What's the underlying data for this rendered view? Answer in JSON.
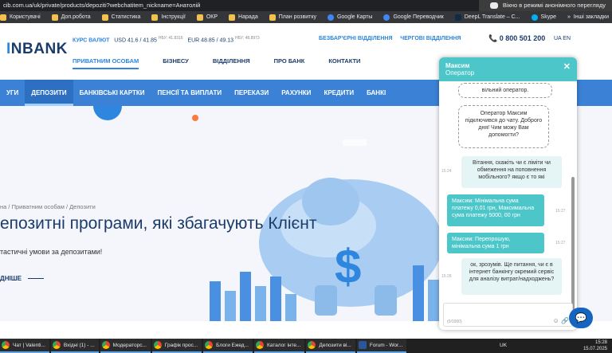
{
  "browser": {
    "url": "cib.com.ua/uk/private/products/depoziti?webchatitem_nickname=Анатолій",
    "incognito_label": "Вікно в режимі анонімного перегляду",
    "bookmarks": [
      "Користувачі",
      "Доп.робота",
      "Статистика",
      "Інструкції",
      "ОКР",
      "Нарада",
      "План розвитку",
      "Google Карты",
      "Google Переводчик",
      "DeepL Translate – С...",
      "Skype"
    ],
    "bookmarks_more": "Інші закладки"
  },
  "header": {
    "logo": "NBANK",
    "logo_prefix": "I",
    "rates_label": "КУРС ВАЛЮТ",
    "usd_label": "USD",
    "usd_value": "41.6 / 41.85",
    "usd_nbu": "НБУ: 41.8316",
    "eur_label": "EUR",
    "eur_value": "48.85 / 49.13",
    "eur_nbu": "НБУ: 48.8973",
    "link_branches": "БЕЗБАР'ЄРНІ ВІДДІЛЕННЯ",
    "link_duty": "ЧЕРГОВІ ВІДДІЛЕННЯ",
    "phone": "0 800 501 200",
    "lang": "UA EN",
    "main_nav": [
      "ПРИВАТНИМ ОСОБАМ",
      "БІЗНЕСУ",
      "ВІДДІЛЕННЯ",
      "ПРО БАНК",
      "КОНТАКТИ"
    ],
    "sub_nav": [
      "УГИ",
      "ДЕПОЗИТИ",
      "БАНКІВСЬКІ КАРТКИ",
      "ПЕНСІЇ ТА ВИПЛАТИ",
      "ПЕРЕКАЗИ",
      "РАХУНКИ",
      "КРЕДИТИ",
      "БАНКІ"
    ]
  },
  "hero": {
    "breadcrumbs": "на / Приватним особам / Депозити",
    "title": "епозитні програми, які збагачують Клієнт",
    "subtitle": "тастичні умови за депозитами!",
    "more": "ДНІШЕ"
  },
  "chat": {
    "agent_name": "Максим",
    "agent_role": "Оператор",
    "messages": [
      {
        "type": "op",
        "text": "вільний оператор."
      },
      {
        "type": "op",
        "text": "Оператор Максим підключився до чату. Доброго дня! Чим можу Вам допомогти?"
      },
      {
        "type": "user",
        "time": "15:24",
        "text": "Вітання, скажіть чи є ліміти чи обмеження на поповнення мобільного? якщо є то які"
      },
      {
        "type": "bot",
        "time": "15:27",
        "text": "Максим: Мінімальна сума платежу 0,01 грн, Максимальна сума платежу 5000, 00 грн"
      },
      {
        "type": "bot",
        "time": "15:27",
        "text": "Максим: Перепрошую, мінімальна сума 1 грн"
      },
      {
        "type": "user",
        "time": "15:28",
        "text": "ок, зрозумів. Ще питання, чи є в інтернет банкінгу окремий сервіс для аналізу витрат/надходжень?"
      }
    ],
    "counter": "(0/1000)"
  },
  "taskbar": {
    "items": [
      "Чат | Valenti...",
      "Вхідні (1) - ...",
      "Модераторс...",
      "Графік прос...",
      "Блоги Ежед...",
      "Каталог інте...",
      "Депозити ві...",
      "Forum - Wor..."
    ],
    "lang": "UK",
    "time": "15:28",
    "date": "15.07.2025"
  },
  "colors": {
    "primary": "#3b82d6",
    "navy": "#1b3c6b",
    "chat_accent": "#4cc6c9"
  }
}
